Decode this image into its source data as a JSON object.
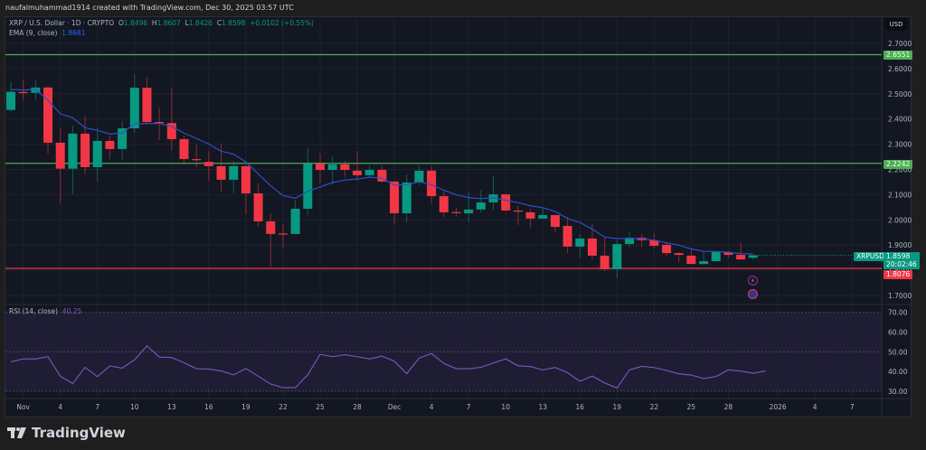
{
  "credit": "naufalmuhammad1914 created with TradingView.com, Dec 30, 2025 03:57 UTC",
  "legend": {
    "symbol": "XRP / U.S. Dollar · 1D · CRYPTO",
    "o_label": "O",
    "o": "1.8496",
    "h_label": "H",
    "h": "1.8607",
    "l_label": "L",
    "l": "1.8426",
    "c_label": "C",
    "c": "1.8598",
    "change": "+0.0102 (+0.55%)",
    "ema_label": "EMA (9, close)",
    "ema_value": "1.8681",
    "rsi_label": "RSI (14, close)",
    "rsi_value": "40.25"
  },
  "currency": "USD",
  "badges": {
    "symbol": "XRPUSD",
    "last_price": "1.8598",
    "countdown": "20:02:46",
    "level_top": "2.6551",
    "level_mid": "2.2242",
    "level_bottom": "1.8076"
  },
  "brand": "TradingView",
  "colors": {
    "up": "#089981",
    "down": "#f23645",
    "ema": "#2f4fc4",
    "rsi": "#7e57c2",
    "level_green": "#4caf50",
    "level_red": "#f23645"
  },
  "icons": [
    "lightning-event-icon",
    "us-flag-event-icon"
  ],
  "chart_data": [
    {
      "type": "candlestick",
      "title": "XRP / U.S. Dollar · 1D · CRYPTO",
      "ylim": [
        1.7,
        2.7
      ],
      "y_ticks": [
        "2.7000",
        "2.6000",
        "2.5000",
        "2.4000",
        "2.3000",
        "2.2000",
        "2.1000",
        "2.0000",
        "1.9000",
        "1.8000",
        "1.7000"
      ],
      "x_ticks": [
        {
          "label": "Nov",
          "date": "2025-11-01"
        },
        {
          "label": "4",
          "date": "2025-11-04"
        },
        {
          "label": "7",
          "date": "2025-11-07"
        },
        {
          "label": "10",
          "date": "2025-11-10"
        },
        {
          "label": "13",
          "date": "2025-11-13"
        },
        {
          "label": "16",
          "date": "2025-11-16"
        },
        {
          "label": "19",
          "date": "2025-11-19"
        },
        {
          "label": "22",
          "date": "2025-11-22"
        },
        {
          "label": "25",
          "date": "2025-11-25"
        },
        {
          "label": "28",
          "date": "2025-11-28"
        },
        {
          "label": "Dec",
          "date": "2025-12-01"
        },
        {
          "label": "4",
          "date": "2025-12-04"
        },
        {
          "label": "7",
          "date": "2025-12-07"
        },
        {
          "label": "10",
          "date": "2025-12-10"
        },
        {
          "label": "13",
          "date": "2025-12-13"
        },
        {
          "label": "16",
          "date": "2025-12-16"
        },
        {
          "label": "19",
          "date": "2025-12-19"
        },
        {
          "label": "22",
          "date": "2025-12-22"
        },
        {
          "label": "25",
          "date": "2025-12-25"
        },
        {
          "label": "28",
          "date": "2025-12-28"
        },
        {
          "label": "2026",
          "date": "2026-01-01"
        },
        {
          "label": "4",
          "date": "2026-01-04"
        },
        {
          "label": "7",
          "date": "2026-01-07"
        }
      ],
      "horizontal_levels": [
        {
          "value": 2.6551,
          "color": "#4caf50"
        },
        {
          "value": 2.2242,
          "color": "#4caf50"
        },
        {
          "value": 1.8076,
          "color": "#f23645"
        }
      ],
      "ema_period": 9,
      "grid": true,
      "candles_columns": [
        "date",
        "open",
        "high",
        "low",
        "close"
      ],
      "candles": [
        [
          "2025-10-31",
          2.436,
          2.549,
          2.431,
          2.508
        ],
        [
          "2025-11-01",
          2.507,
          2.557,
          2.474,
          2.505
        ],
        [
          "2025-11-02",
          2.504,
          2.553,
          2.474,
          2.525
        ],
        [
          "2025-11-03",
          2.525,
          2.532,
          2.263,
          2.306
        ],
        [
          "2025-11-04",
          2.306,
          2.363,
          2.066,
          2.203
        ],
        [
          "2025-11-05",
          2.203,
          2.374,
          2.101,
          2.342
        ],
        [
          "2025-11-06",
          2.342,
          2.413,
          2.18,
          2.209
        ],
        [
          "2025-11-07",
          2.209,
          2.367,
          2.152,
          2.313
        ],
        [
          "2025-11-08",
          2.313,
          2.334,
          2.241,
          2.281
        ],
        [
          "2025-11-09",
          2.281,
          2.392,
          2.238,
          2.363
        ],
        [
          "2025-11-10",
          2.363,
          2.578,
          2.345,
          2.524
        ],
        [
          "2025-11-11",
          2.524,
          2.567,
          2.377,
          2.388
        ],
        [
          "2025-11-12",
          2.388,
          2.446,
          2.316,
          2.384
        ],
        [
          "2025-11-13",
          2.384,
          2.524,
          2.277,
          2.32
        ],
        [
          "2025-11-14",
          2.32,
          2.334,
          2.22,
          2.241
        ],
        [
          "2025-11-15",
          2.241,
          2.299,
          2.209,
          2.237
        ],
        [
          "2025-11-16",
          2.23,
          2.273,
          2.155,
          2.213
        ],
        [
          "2025-11-17",
          2.213,
          2.302,
          2.112,
          2.159
        ],
        [
          "2025-11-18",
          2.159,
          2.234,
          2.105,
          2.213
        ],
        [
          "2025-11-19",
          2.213,
          2.213,
          2.023,
          2.105
        ],
        [
          "2025-11-20",
          2.105,
          2.144,
          1.972,
          1.994
        ],
        [
          "2025-11-21",
          1.994,
          2.026,
          1.815,
          1.944
        ],
        [
          "2025-11-22",
          1.946,
          1.983,
          1.886,
          1.942
        ],
        [
          "2025-11-23",
          1.944,
          2.08,
          1.944,
          2.044
        ],
        [
          "2025-11-24",
          2.044,
          2.284,
          2.019,
          2.223
        ],
        [
          "2025-11-25",
          2.223,
          2.263,
          2.144,
          2.198
        ],
        [
          "2025-11-26",
          2.198,
          2.252,
          2.141,
          2.22
        ],
        [
          "2025-11-27",
          2.22,
          2.234,
          2.17,
          2.198
        ],
        [
          "2025-11-28",
          2.195,
          2.273,
          2.155,
          2.177
        ],
        [
          "2025-11-29",
          2.177,
          2.216,
          2.17,
          2.198
        ],
        [
          "2025-11-30",
          2.198,
          2.213,
          2.148,
          2.152
        ],
        [
          "2025-12-01",
          2.152,
          2.152,
          1.983,
          2.026
        ],
        [
          "2025-12-02",
          2.026,
          2.18,
          1.99,
          2.148
        ],
        [
          "2025-12-03",
          2.148,
          2.216,
          2.137,
          2.195
        ],
        [
          "2025-12-04",
          2.195,
          2.213,
          2.066,
          2.094
        ],
        [
          "2025-12-05",
          2.094,
          2.112,
          2.012,
          2.03
        ],
        [
          "2025-12-06",
          2.031,
          2.048,
          2.012,
          2.028
        ],
        [
          "2025-12-07",
          2.026,
          2.109,
          1.99,
          2.041
        ],
        [
          "2025-12-08",
          2.041,
          2.119,
          2.03,
          2.069
        ],
        [
          "2025-12-09",
          2.069,
          2.173,
          2.041,
          2.101
        ],
        [
          "2025-12-10",
          2.101,
          2.105,
          2.033,
          2.037
        ],
        [
          "2025-12-11",
          2.037,
          2.055,
          1.98,
          2.033
        ],
        [
          "2025-12-12",
          2.03,
          2.044,
          1.969,
          2.005
        ],
        [
          "2025-12-13",
          2.005,
          2.048,
          2.005,
          2.019
        ],
        [
          "2025-12-14",
          2.019,
          2.019,
          1.951,
          1.972
        ],
        [
          "2025-12-15",
          1.976,
          2.012,
          1.868,
          1.894
        ],
        [
          "2025-12-16",
          1.894,
          1.944,
          1.851,
          1.926
        ],
        [
          "2025-12-17",
          1.926,
          1.983,
          1.843,
          1.858
        ],
        [
          "2025-12-18",
          1.858,
          1.933,
          1.797,
          1.804
        ],
        [
          "2025-12-19",
          1.804,
          1.919,
          1.768,
          1.904
        ],
        [
          "2025-12-20",
          1.904,
          1.954,
          1.89,
          1.929
        ],
        [
          "2025-12-21",
          1.929,
          1.944,
          1.894,
          1.919
        ],
        [
          "2025-12-22",
          1.919,
          1.944,
          1.886,
          1.897
        ],
        [
          "2025-12-23",
          1.901,
          1.911,
          1.858,
          1.868
        ],
        [
          "2025-12-24",
          1.868,
          1.872,
          1.833,
          1.861
        ],
        [
          "2025-12-25",
          1.858,
          1.883,
          1.825,
          1.825
        ],
        [
          "2025-12-26",
          1.825,
          1.872,
          1.822,
          1.836
        ],
        [
          "2025-12-27",
          1.836,
          1.876,
          1.836,
          1.872
        ],
        [
          "2025-12-28",
          1.872,
          1.876,
          1.851,
          1.861
        ],
        [
          "2025-12-29",
          1.861,
          1.911,
          1.843,
          1.843
        ],
        [
          "2025-12-30",
          1.8496,
          1.8607,
          1.8426,
          1.8598
        ]
      ]
    },
    {
      "type": "line",
      "title": "RSI (14, close)",
      "ylim": [
        25,
        75
      ],
      "y_ticks": [
        "70.00",
        "60.00",
        "50.00",
        "40.00",
        "30.00"
      ],
      "bands": [
        70,
        50,
        30
      ],
      "values": [
        44.9,
        46.4,
        46.4,
        47.5,
        37.6,
        33.9,
        42.1,
        37.4,
        42.8,
        41.7,
        45.9,
        53.0,
        47.3,
        47.1,
        44.4,
        41.4,
        41.2,
        40.3,
        38.3,
        41.5,
        37.6,
        33.6,
        31.8,
        31.8,
        38.3,
        48.7,
        47.5,
        48.5,
        47.5,
        46.4,
        47.8,
        45.2,
        38.9,
        46.8,
        49.1,
        44.1,
        41.4,
        41.4,
        42.1,
        44.3,
        46.4,
        42.9,
        42.5,
        40.8,
        42.0,
        39.4,
        35.0,
        37.7,
        34.2,
        31.6,
        40.8,
        42.6,
        42.0,
        40.5,
        38.8,
        38.2,
        36.4,
        37.4,
        40.8,
        40.2,
        39.1,
        40.25
      ]
    }
  ]
}
